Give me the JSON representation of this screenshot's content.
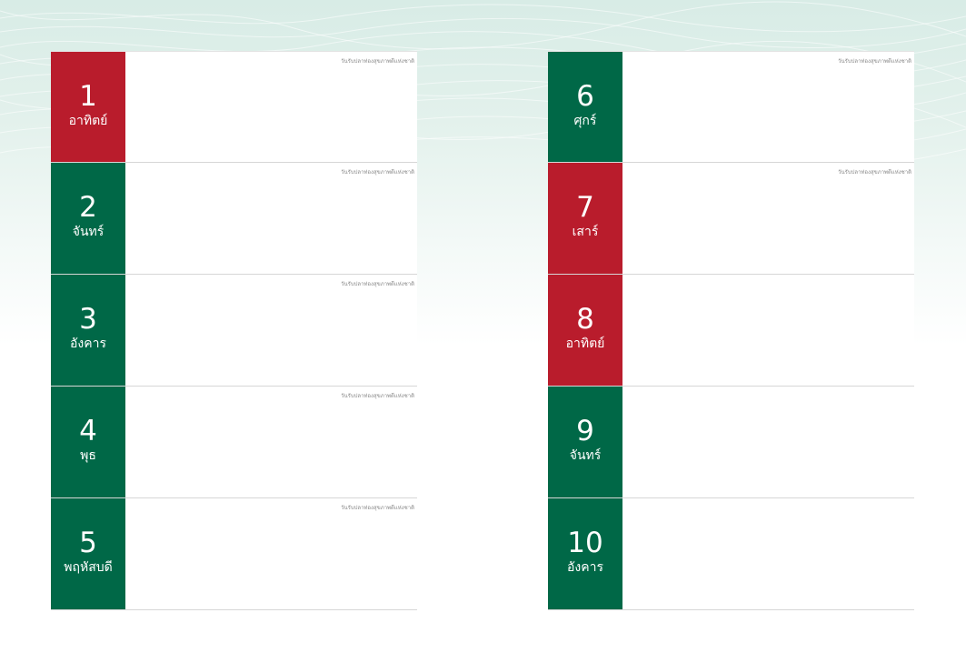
{
  "left_column": [
    {
      "num": "1",
      "day": "อาทิตย์",
      "color": "red",
      "note": "วันรับปลาท่องสุขภาพดีแห่งชาติ"
    },
    {
      "num": "2",
      "day": "จันทร์",
      "color": "green",
      "note": "วันรับปลาท่องสุขภาพดีแห่งชาติ"
    },
    {
      "num": "3",
      "day": "อังคาร",
      "color": "green",
      "note": "วันรับปลาท่องสุขภาพดีแห่งชาติ"
    },
    {
      "num": "4",
      "day": "พุธ",
      "color": "green",
      "note": "วันรับปลาท่องสุขภาพดีแห่งชาติ"
    },
    {
      "num": "5",
      "day": "พฤหัสบดี",
      "color": "green",
      "note": "วันรับปลาท่องสุขภาพดีแห่งชาติ"
    }
  ],
  "right_column": [
    {
      "num": "6",
      "day": "ศุกร์",
      "color": "green",
      "note": "วันรับปลาท่องสุขภาพดีแห่งชาติ"
    },
    {
      "num": "7",
      "day": "เสาร์",
      "color": "red",
      "note": "วันรับปลาท่องสุขภาพดีแห่งชาติ"
    },
    {
      "num": "8",
      "day": "อาทิตย์",
      "color": "red",
      "note": ""
    },
    {
      "num": "9",
      "day": "จันทร์",
      "color": "green",
      "note": ""
    },
    {
      "num": "10",
      "day": "อังคาร",
      "color": "green",
      "note": ""
    }
  ],
  "colors": {
    "green": "#006847",
    "red": "#b91c2c"
  }
}
